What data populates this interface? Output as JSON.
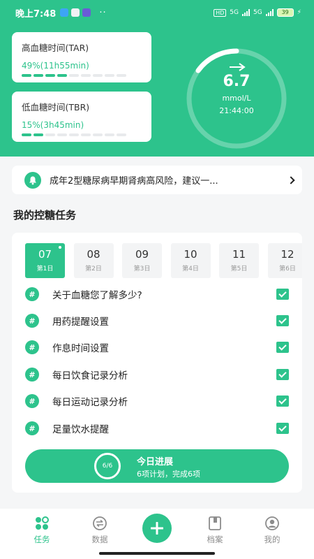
{
  "status_bar": {
    "time": "晚上7:48",
    "dots": "··",
    "hd": "HD",
    "network_1": "5G",
    "network_2": "5G",
    "battery": "39"
  },
  "metrics": {
    "tar": {
      "title": "高血糖时间(TAR)",
      "value": "49%(11h55min)",
      "filled_segments": 4,
      "total_segments": 9
    },
    "tbr": {
      "title": "低血糖时间(TBR)",
      "value": "15%(3h45min)",
      "filled_segments": 2,
      "total_segments": 9
    }
  },
  "glucose": {
    "value": "6.7",
    "unit": "mmol/L",
    "time": "21:44:00",
    "trend": "arrow-right-icon",
    "gauge_fraction": 0.15
  },
  "alert": {
    "text": "成年2型糖尿病早期肾病高风险，建议一..."
  },
  "section": {
    "title": "我的控糖任务"
  },
  "days": [
    {
      "num": "07",
      "label": "第1日",
      "active": true
    },
    {
      "num": "08",
      "label": "第2日",
      "active": false
    },
    {
      "num": "09",
      "label": "第3日",
      "active": false
    },
    {
      "num": "10",
      "label": "第4日",
      "active": false
    },
    {
      "num": "11",
      "label": "第5日",
      "active": false
    },
    {
      "num": "12",
      "label": "第6日",
      "active": false
    }
  ],
  "tasks": [
    {
      "icon": "#",
      "label": "关于血糖您了解多少?",
      "done": true
    },
    {
      "icon": "#",
      "label": "用药提醒设置",
      "done": true
    },
    {
      "icon": "#",
      "label": "作息时间设置",
      "done": true
    },
    {
      "icon": "#",
      "label": "每日饮食记录分析",
      "done": true
    },
    {
      "icon": "#",
      "label": "每日运动记录分析",
      "done": true
    },
    {
      "icon": "#",
      "label": "足量饮水提醒",
      "done": true
    }
  ],
  "progress": {
    "ring": "6/6",
    "title": "今日进展",
    "subtitle": "6项计划，完成6项"
  },
  "nav": {
    "items": [
      {
        "label": "任务",
        "icon": "task-dots-icon",
        "active": true
      },
      {
        "label": "数据",
        "icon": "data-exchange-icon",
        "active": false
      },
      {
        "label": "",
        "icon": "plus-icon",
        "active": false
      },
      {
        "label": "档案",
        "icon": "archive-icon",
        "active": false
      },
      {
        "label": "我的",
        "icon": "profile-icon",
        "active": false
      }
    ]
  },
  "colors": {
    "brand": "#2dc38c",
    "background": "#f5f6f7"
  }
}
